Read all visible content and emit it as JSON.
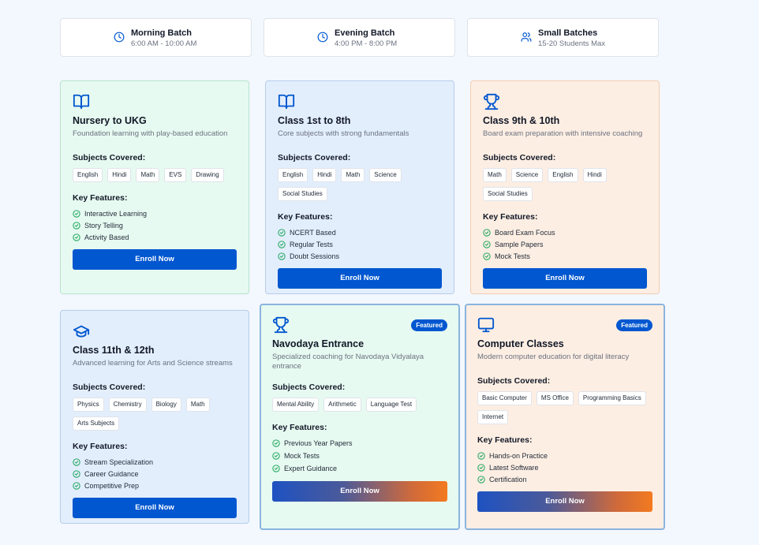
{
  "batches": [
    {
      "title": "Morning Batch",
      "sub": "6:00 AM - 10:00 AM",
      "icon": "clock-icon"
    },
    {
      "title": "Evening Batch",
      "sub": "4:00 PM - 8:00 PM",
      "icon": "clock-icon"
    },
    {
      "title": "Small Batches",
      "sub": "15-20 Students Max",
      "icon": "users-icon"
    }
  ],
  "labels": {
    "subjects_heading": "Subjects Covered:",
    "features_heading": "Key Features:",
    "enroll": "Enroll Now",
    "featured": "Featured"
  },
  "colors": {
    "accent": "#0057d0",
    "check": "#22a861",
    "gradient_end": "#f37a20"
  },
  "courses": [
    {
      "title": "Nursery to UKG",
      "desc": "Foundation learning with play-based education",
      "icon": "book-icon",
      "subjects": [
        "English",
        "Hindi",
        "Math",
        "EVS",
        "Drawing"
      ],
      "features": [
        "Interactive Learning",
        "Story Telling",
        "Activity Based"
      ]
    },
    {
      "title": "Class 1st to 8th",
      "desc": "Core subjects with strong fundamentals",
      "icon": "book-icon",
      "subjects": [
        "English",
        "Hindi",
        "Math",
        "Science",
        "Social Studies"
      ],
      "features": [
        "NCERT Based",
        "Regular Tests",
        "Doubt Sessions"
      ]
    },
    {
      "title": "Class 9th & 10th",
      "desc": "Board exam preparation with intensive coaching",
      "icon": "trophy-icon",
      "subjects": [
        "Math",
        "Science",
        "English",
        "Hindi",
        "Social Studies"
      ],
      "features": [
        "Board Exam Focus",
        "Sample Papers",
        "Mock Tests"
      ]
    },
    {
      "title": "Class 11th & 12th",
      "desc": "Advanced learning for Arts and Science streams",
      "icon": "graduation-cap-icon",
      "subjects": [
        "Physics",
        "Chemistry",
        "Biology",
        "Math",
        "Arts Subjects"
      ],
      "features": [
        "Stream Specialization",
        "Career Guidance",
        "Competitive Prep"
      ]
    },
    {
      "title": "Navodaya Entrance",
      "desc": "Specialized coaching for Navodaya Vidyalaya entrance",
      "icon": "trophy-icon",
      "featured": true,
      "subjects": [
        "Mental Ability",
        "Arithmetic",
        "Language Test"
      ],
      "features": [
        "Previous Year Papers",
        "Mock Tests",
        "Expert Guidance"
      ]
    },
    {
      "title": "Computer Classes",
      "desc": "Modern computer education for digital literacy",
      "icon": "monitor-icon",
      "featured": true,
      "subjects": [
        "Basic Computer",
        "MS Office",
        "Programming Basics",
        "Internet"
      ],
      "features": [
        "Hands-on Practice",
        "Latest Software",
        "Certification"
      ]
    }
  ]
}
